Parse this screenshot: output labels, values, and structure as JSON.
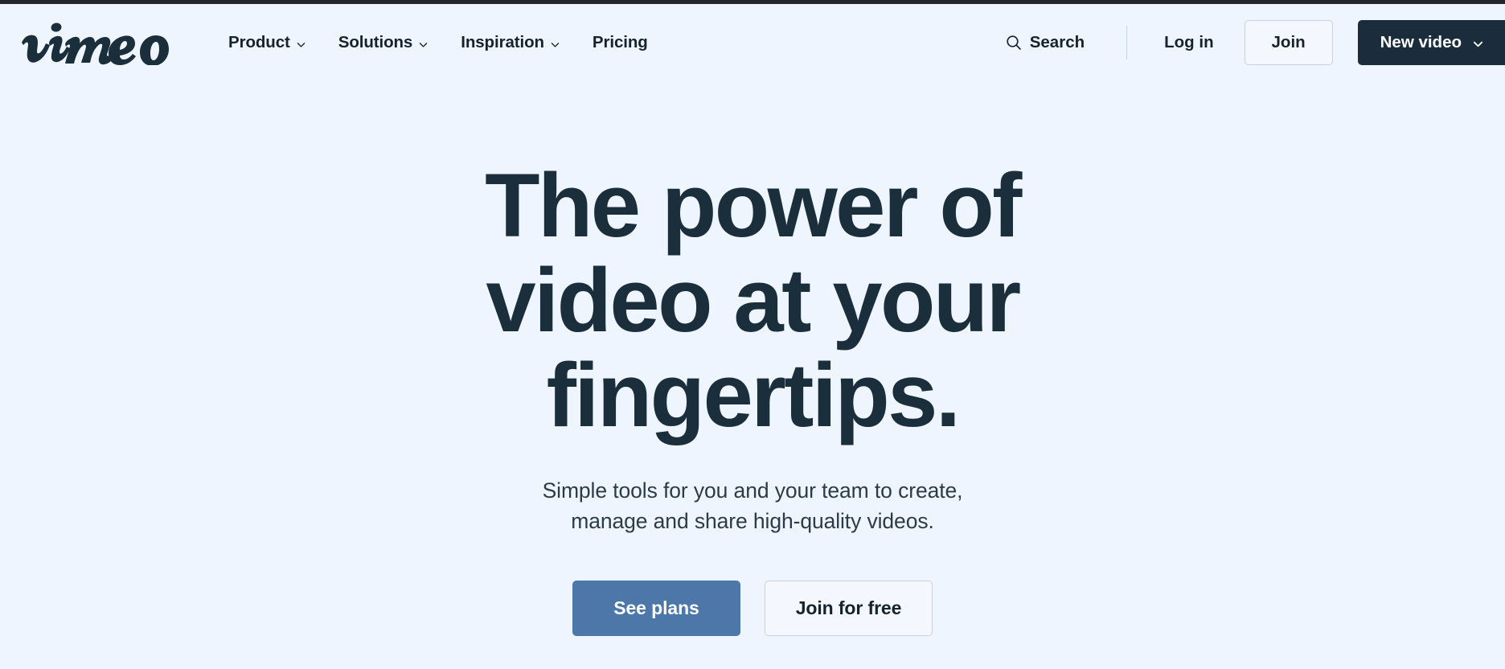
{
  "browser": {
    "chrome_bar_color": "#22272b"
  },
  "theme": {
    "background": "#eff5fe",
    "text_dark": "#16232e",
    "headline_color": "#1b2e3c",
    "primary_button_bg": "#4e77a9",
    "dark_button_bg": "#1b2d3c",
    "border": "#c5d2e0"
  },
  "header": {
    "logo_alt": "vimeo",
    "nav": [
      {
        "label": "Product",
        "icon": "chevron-down-icon",
        "has_dropdown": true
      },
      {
        "label": "Solutions",
        "icon": "chevron-down-icon",
        "has_dropdown": true
      },
      {
        "label": "Inspiration",
        "icon": "chevron-down-icon",
        "has_dropdown": true
      },
      {
        "label": "Pricing",
        "icon": "",
        "has_dropdown": false
      }
    ],
    "search": {
      "label": "Search",
      "icon": "search-icon"
    },
    "login_label": "Log in",
    "join_label": "Join",
    "new_video": {
      "label": "New video",
      "icon": "chevron-down-icon"
    }
  },
  "hero": {
    "headline_line1": "The power of",
    "headline_line2": "video at your",
    "headline_line3": "fingertips.",
    "subtitle_line1": "Simple tools for you and your team to create,",
    "subtitle_line2": "manage and share high-quality videos.",
    "cta_primary": "See plans",
    "cta_secondary": "Join for free"
  }
}
